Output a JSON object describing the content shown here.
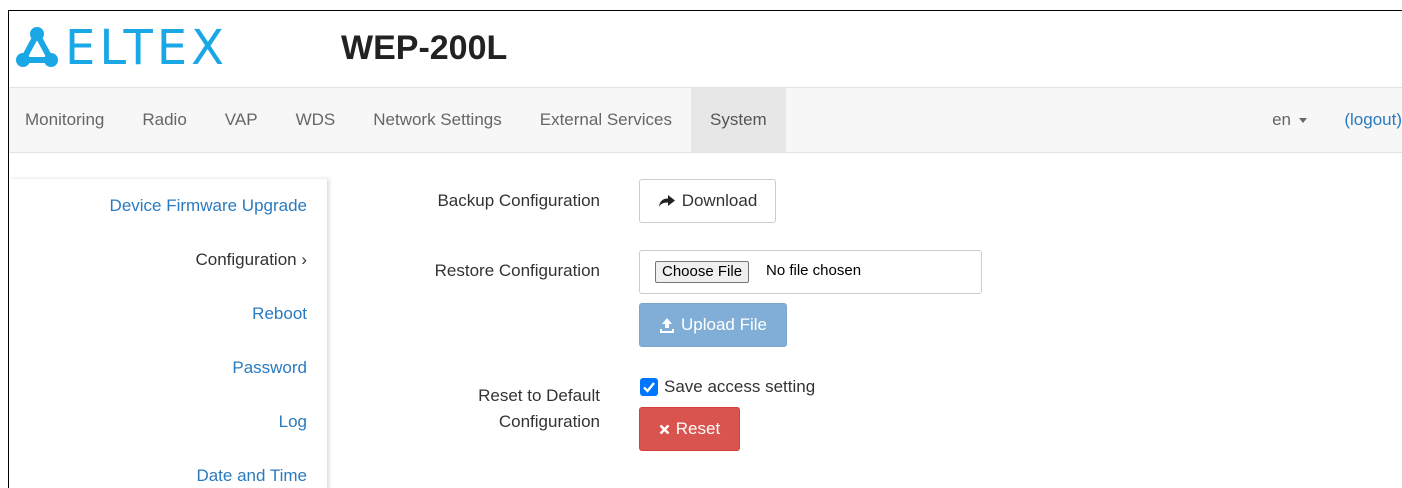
{
  "brand": {
    "logo_text": "ELTEX",
    "model": "WEP-200L",
    "accent_color": "#1aa7e6"
  },
  "nav": {
    "items": [
      {
        "label": "Monitoring"
      },
      {
        "label": "Radio"
      },
      {
        "label": "VAP"
      },
      {
        "label": "WDS"
      },
      {
        "label": "Network Settings"
      },
      {
        "label": "External Services"
      },
      {
        "label": "System"
      }
    ],
    "active": "System",
    "language": "en",
    "logout": "(logout)"
  },
  "sidebar": {
    "items": [
      {
        "label": "Device Firmware Upgrade"
      },
      {
        "label": "Configuration ›"
      },
      {
        "label": "Reboot"
      },
      {
        "label": "Password"
      },
      {
        "label": "Log"
      },
      {
        "label": "Date and Time"
      }
    ],
    "active": "Configuration"
  },
  "main": {
    "backup": {
      "label": "Backup Configuration",
      "button": "Download",
      "icon": "share-arrow-icon"
    },
    "restore": {
      "label": "Restore Configuration",
      "choose_button": "Choose File",
      "file_status": "No file chosen",
      "upload_button": "Upload File",
      "upload_icon": "upload-icon"
    },
    "reset": {
      "label_line1": "Reset to Default",
      "label_line2": "Configuration",
      "checkbox_label": "Save access setting",
      "checkbox_checked": true,
      "button": "Reset",
      "icon": "x-icon"
    }
  },
  "colors": {
    "link": "#2a7ac0",
    "primary_disabled": "#81aed6",
    "danger": "#d9534f",
    "checkbox": "#0075ff"
  }
}
